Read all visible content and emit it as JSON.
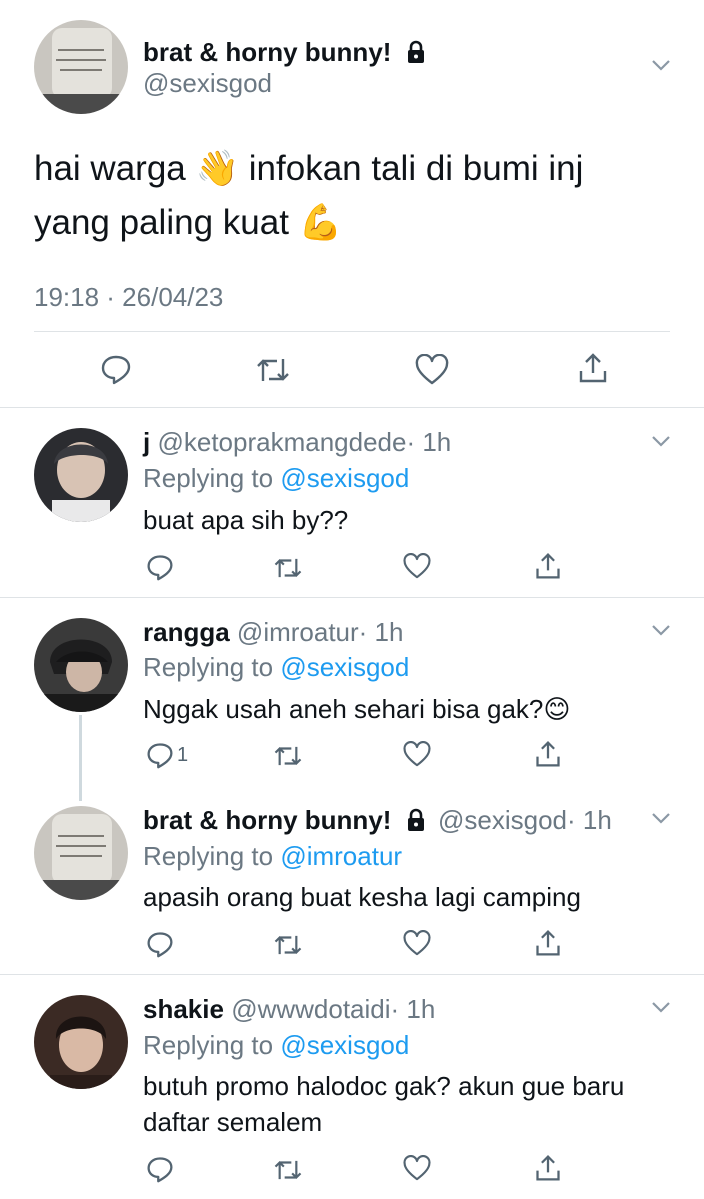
{
  "main_tweet": {
    "display_name": "brat & horny bunny!",
    "handle": "@sexisgod",
    "text_line1": "hai warga 👋 infokan tali di bumi inj",
    "text_line2": "yang paling kuat 💪",
    "timestamp": "19:18 · 26/04/23"
  },
  "replies": [
    {
      "display_name": "j",
      "handle": "@ketoprakmangdede",
      "time": "· 1h",
      "replying_prefix": "Replying to",
      "replying_to": "@sexisgod",
      "text": "buat apa sih by??"
    },
    {
      "display_name": "rangga",
      "handle": "@imroatur",
      "time": "· 1h",
      "replying_prefix": "Replying to",
      "replying_to": "@sexisgod",
      "text": "Nggak usah aneh sehari bisa gak?😊",
      "reply_count": "1"
    },
    {
      "display_name": "brat & horny bunny!",
      "handle": "@sexisgod",
      "time": "· 1h",
      "replying_prefix": "Replying to",
      "replying_to": "@imroatur",
      "text": "apasih orang buat kesha lagi camping"
    },
    {
      "display_name": "shakie",
      "handle": "@wwwdotaidi",
      "time": "· 1h",
      "replying_prefix": "Replying to",
      "replying_to": "@sexisgod",
      "text_line1": "butuh promo halodoc gak? akun gue baru",
      "text_line2": "daftar semalem"
    }
  ],
  "colors": {
    "text": "#0f1419",
    "muted": "#6b7883",
    "link": "#1d9bf0",
    "divider": "#dfe3e6"
  },
  "icons": [
    "lock-icon",
    "chevron-down-icon",
    "reply-icon",
    "retweet-icon",
    "like-icon",
    "share-icon"
  ]
}
